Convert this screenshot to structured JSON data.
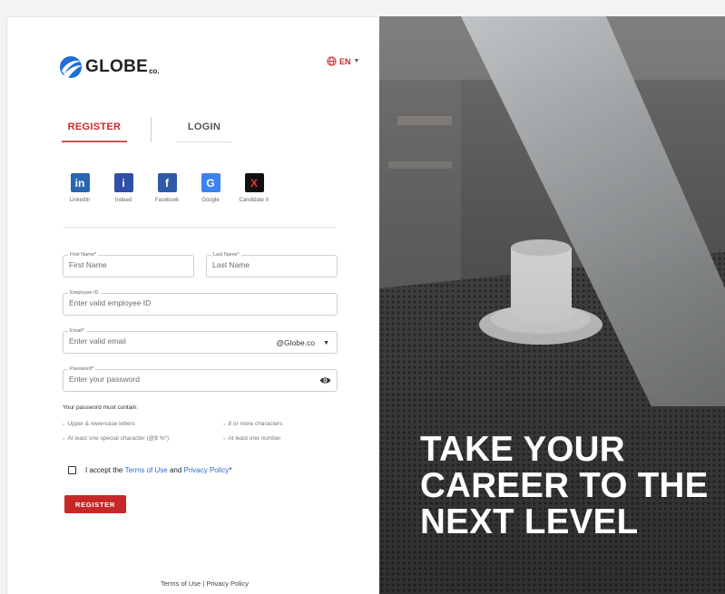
{
  "brand": {
    "name": "GLOBE",
    "suffix": "co."
  },
  "language": {
    "label": "EN"
  },
  "tabs": [
    {
      "label": "REGISTER",
      "active": true
    },
    {
      "label": "LOGIN",
      "active": false
    }
  ],
  "social": [
    {
      "label": "LinkedIn",
      "icon": "linkedin-icon",
      "glyph": "in",
      "color": "#2866b0"
    },
    {
      "label": "Indeed",
      "icon": "indeed-icon",
      "glyph": "i",
      "color": "#2f4fa8"
    },
    {
      "label": "Facebook",
      "icon": "facebook-icon",
      "glyph": "f",
      "color": "#2e5aa8"
    },
    {
      "label": "Google",
      "icon": "google-icon",
      "glyph": "G",
      "color": "#3d82f0"
    },
    {
      "label": "Candidate X",
      "icon": "candidate-x-icon",
      "glyph": "X",
      "color": "#111111"
    }
  ],
  "form": {
    "first_name": {
      "label": "First Name*",
      "placeholder": "First Name",
      "value": ""
    },
    "last_name": {
      "label": "Last Name*",
      "placeholder": "Last Name",
      "value": ""
    },
    "employee_id": {
      "label": "Employee ID",
      "placeholder": "Enter valid employee ID",
      "value": ""
    },
    "email": {
      "label": "Email*",
      "placeholder": "Enter valid email",
      "value": "",
      "domain": "@Globe.co"
    },
    "password": {
      "label": "Password*",
      "placeholder": "Enter your password",
      "value": ""
    }
  },
  "password_rules": {
    "title": "Your password must contain:",
    "items": [
      "Upper & lowercase letters",
      "8 or more characters",
      "At least one special character (@$ %*)",
      "At least one number"
    ]
  },
  "terms": {
    "prefix": "I accept the ",
    "terms_link": "Terms of Use",
    "middle": " and ",
    "privacy_link": "Privacy Policy",
    "suffix": "*",
    "checked": false
  },
  "register_button": "REGISTER",
  "footer": {
    "terms": "Terms of Use",
    "separator": " | ",
    "privacy": "Privacy Policy"
  },
  "hero": {
    "line1": "TAKE YOUR",
    "line2": "CAREER TO THE",
    "line3": "NEXT LEVEL"
  },
  "colors": {
    "accent": "#c62828",
    "link": "#1e6fd9",
    "brand_blue": "#1e6fd9"
  }
}
